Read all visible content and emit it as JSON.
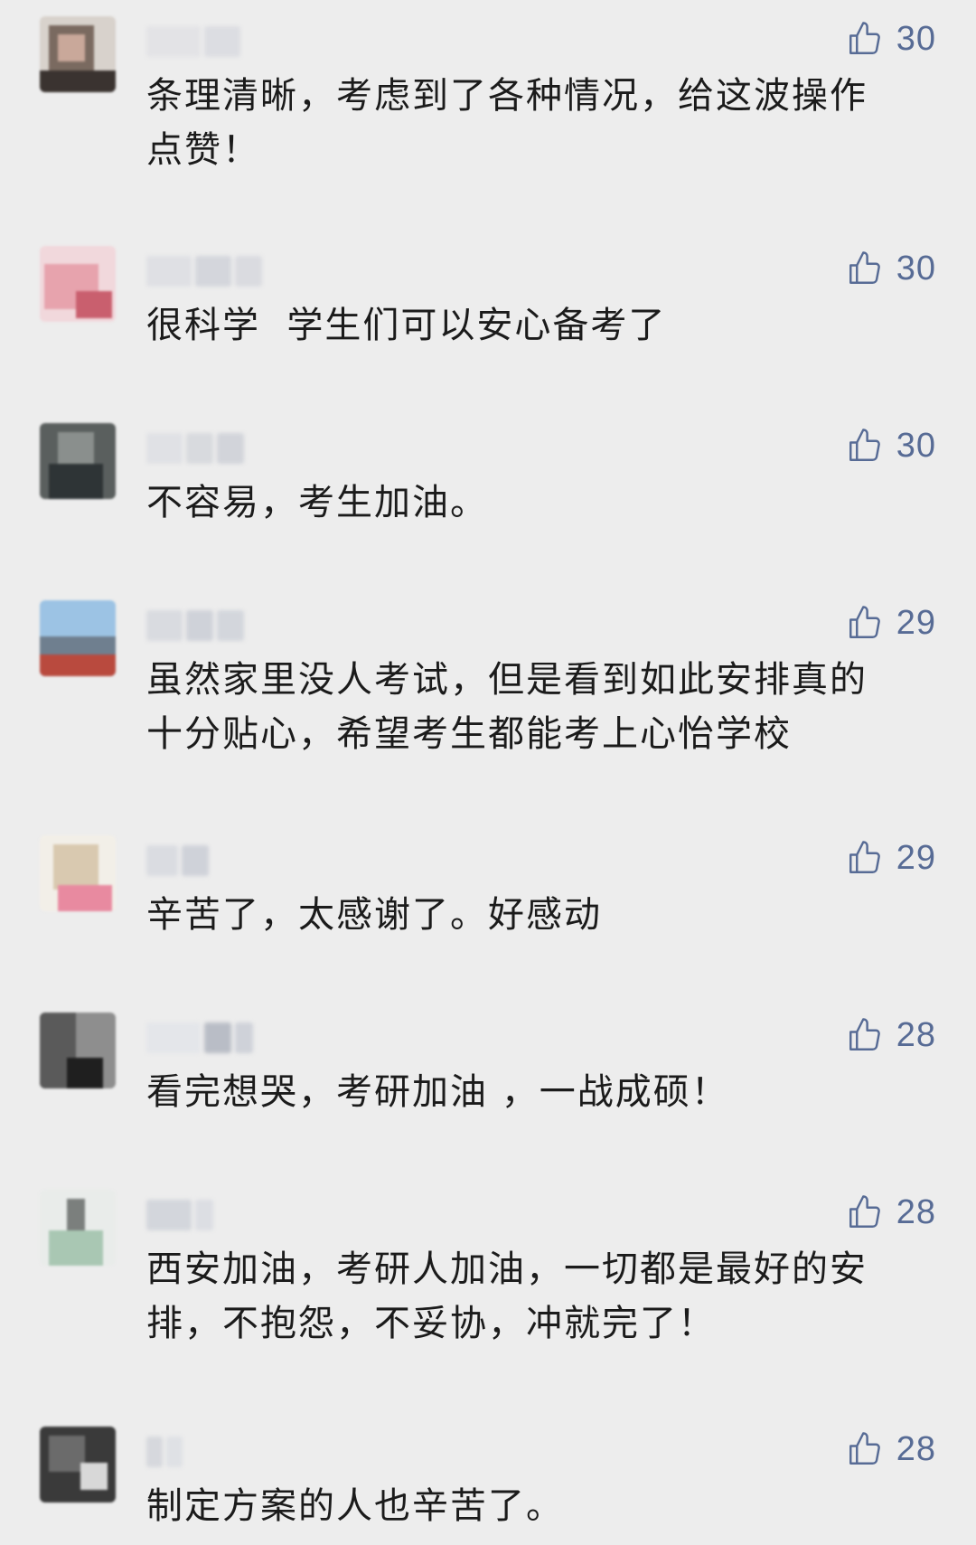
{
  "colors": {
    "background": "#ededed",
    "accent": "#576b95",
    "text": "#1b1b1b"
  },
  "like_icon": "thumbs-up-icon",
  "comments": [
    {
      "likes": "30",
      "text": "条理清晰，考虑到了各种情况，给这波操作\n点赞！"
    },
    {
      "likes": "30",
      "text": "很科学  学生们可以安心备考了"
    },
    {
      "likes": "30",
      "text": "不容易，考生加油。"
    },
    {
      "likes": "29",
      "text": "虽然家里没人考试，但是看到如此安排真的\n十分贴心，希望考生都能考上心怡学校"
    },
    {
      "likes": "29",
      "text": "辛苦了，太感谢了。好感动"
    },
    {
      "likes": "28",
      "text": "看完想哭，考研加油 ，一战成硕！"
    },
    {
      "likes": "28",
      "text": "西安加油，考研人加油，一切都是最好的安\n排，不抱怨，不妥协，冲就完了！"
    },
    {
      "likes": "28",
      "text": "制定方案的人也辛苦了。"
    }
  ]
}
